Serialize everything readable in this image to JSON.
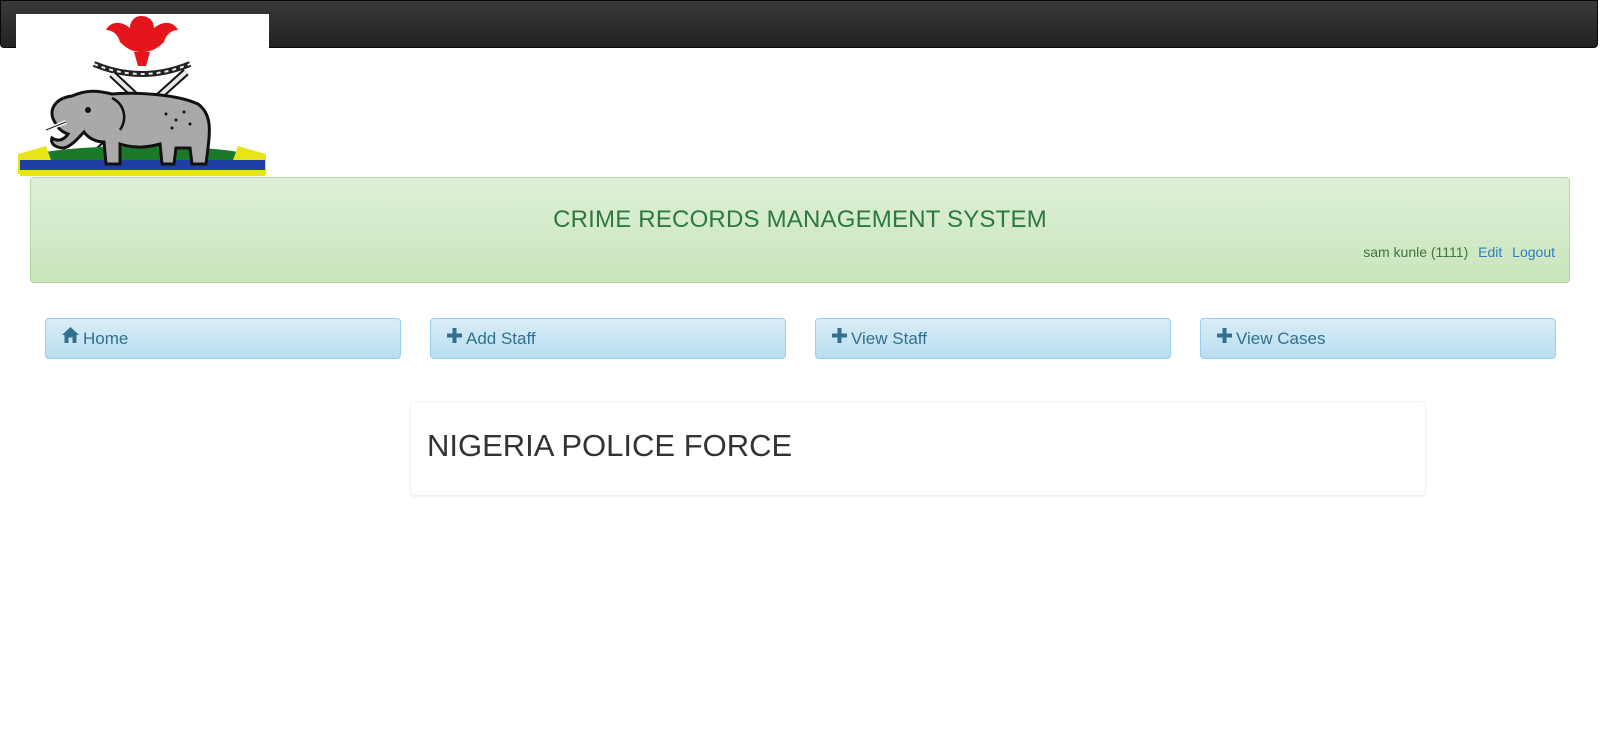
{
  "header": {
    "logo_icon": "police-crest-icon"
  },
  "banner": {
    "title": "CRIME RECORDS MANAGEMENT SYSTEM",
    "user_label": "sam kunle (1111)",
    "edit_label": "Edit",
    "logout_label": "Logout"
  },
  "nav": {
    "items": [
      {
        "icon": "home-icon",
        "label": "Home"
      },
      {
        "icon": "plus-icon",
        "label": "Add Staff"
      },
      {
        "icon": "plus-icon",
        "label": "View Staff"
      },
      {
        "icon": "plus-icon",
        "label": "View Cases"
      }
    ]
  },
  "main": {
    "heading": "NIGERIA POLICE FORCE"
  },
  "colors": {
    "navbar": "#222222",
    "banner_bg": "#dff0d8",
    "banner_text": "#2b7a3d",
    "nav_bg": "#d9edf7",
    "nav_text": "#31708f",
    "link": "#2a7fc1"
  }
}
